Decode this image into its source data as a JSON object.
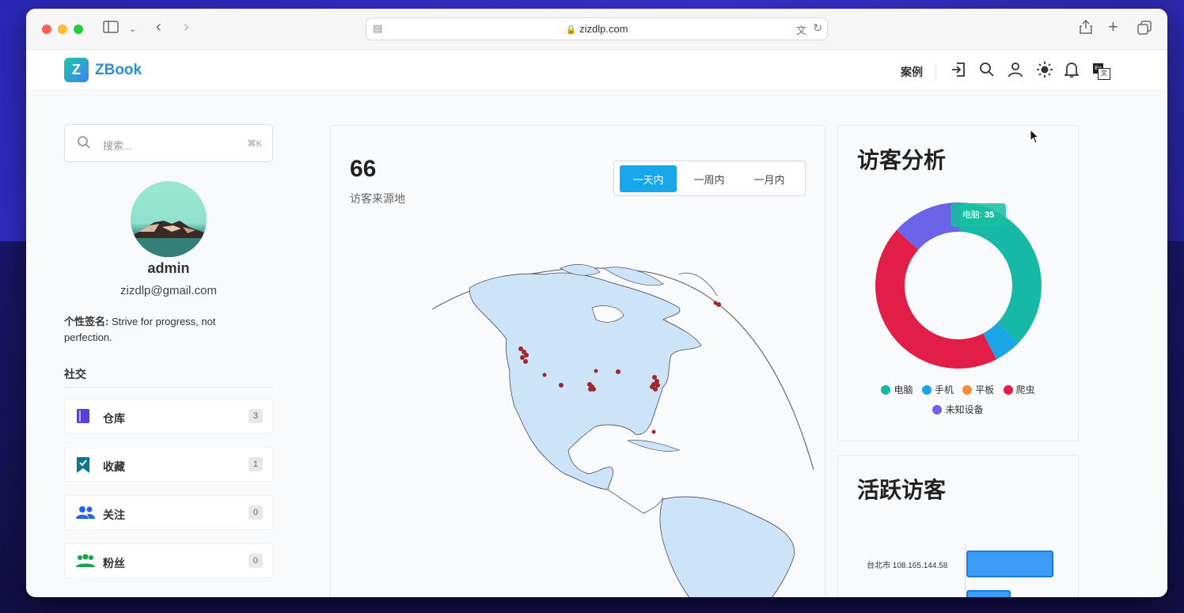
{
  "browser": {
    "url": "zizdlp.com"
  },
  "site": {
    "logo_text": "ZBook",
    "logo_mark": "Z",
    "nav_case": "案例",
    "lang_badge": "En",
    "lang_badge2": "文"
  },
  "search": {
    "placeholder": "搜索...",
    "shortcut": "⌘K"
  },
  "profile": {
    "username": "admin",
    "email": "zizdlp@gmail.com",
    "signature_label": "个性签名:",
    "signature_text": "Strive for progress, not perfection."
  },
  "social": {
    "title": "社交",
    "items": [
      {
        "label": "仓库",
        "count": "3",
        "icon": "book-icon",
        "color": "#5b3fd1"
      },
      {
        "label": "收藏",
        "count": "1",
        "icon": "bookmark-icon",
        "color": "#0e7490"
      },
      {
        "label": "关注",
        "count": "0",
        "icon": "users-icon",
        "color": "#2563eb"
      },
      {
        "label": "粉丝",
        "count": "0",
        "icon": "group-icon",
        "color": "#16a34a"
      }
    ]
  },
  "visitors_map": {
    "count": "66",
    "subtitle": "访客来源地",
    "ranges": [
      "一天内",
      "一周内",
      "一月内"
    ],
    "active_range": "一天内"
  },
  "visitor_analysis": {
    "title": "访客分析",
    "tooltip_label": "电脑:",
    "tooltip_value": "35",
    "legend": [
      {
        "name": "电脑",
        "color": "#17b8a6"
      },
      {
        "name": "手机",
        "color": "#19a5e6"
      },
      {
        "name": "平板",
        "color": "#f28c44"
      },
      {
        "name": "爬虫",
        "color": "#e11d48"
      },
      {
        "name": "未知设备",
        "color": "#6b63e8"
      }
    ]
  },
  "chart_data": {
    "type": "pie",
    "categories": [
      "电脑",
      "手机",
      "平板",
      "爬虫",
      "未知设备"
    ],
    "values": [
      35,
      5,
      0,
      42,
      13
    ],
    "title": "访客分析"
  },
  "active_visitors": {
    "title": "活跃访客",
    "first_row_label": "台北市 108.165.144.58"
  }
}
